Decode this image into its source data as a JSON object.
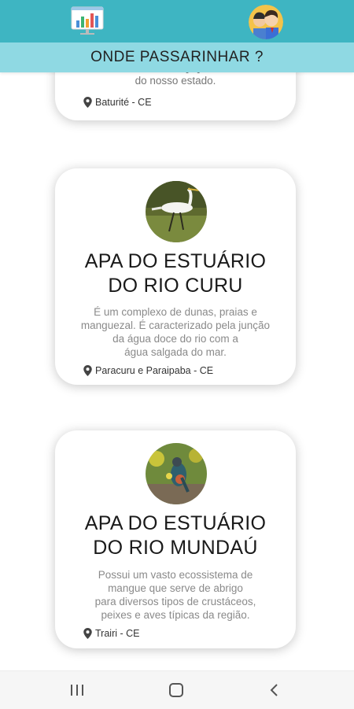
{
  "header": {
    "title": "ONDE PASSARINHAR ?",
    "chart_icon": "dashboard-chart-icon",
    "profile_icon": "profile-avatar-icon",
    "colors": {
      "topbar": "#3eb5c2",
      "subheader": "#8fd9e3"
    }
  },
  "cards": [
    {
      "title": "",
      "description": "Ceará, [...]\ndo nosso estado.",
      "location": "Baturité - CE"
    },
    {
      "title": "APA DO ESTUÁRIO\nDO RIO CURU",
      "description": "É um complexo de dunas, praias e\nmanguezal. É caracterizado pela junção\nda água doce do rio  com a\nágua salgada do mar.",
      "location": "Paracuru e Paraipaba - CE",
      "image_icon": "egret-photo"
    },
    {
      "title": "APA DO ESTUÁRIO\nDO RIO MUNDAÚ",
      "description": "Possui um vasto ecossistema de\nmangue  que serve de abrigo\npara diversos tipos de crustáceos,\npeixes e aves típicas da região.",
      "location": "Trairi - CE",
      "image_icon": "colorful-bird-photo"
    }
  ],
  "navbar": {
    "recent_icon": "recent-apps-icon",
    "home_icon": "home-icon",
    "back_icon": "back-icon"
  }
}
